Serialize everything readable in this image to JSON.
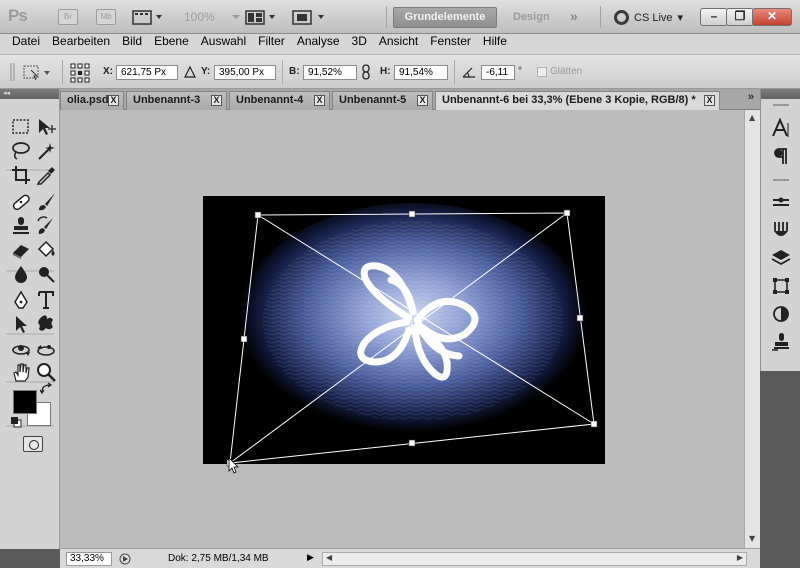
{
  "app": {
    "logo": "Ps",
    "bridge_label": "Br",
    "minibridge_label": "Mb",
    "zoom": "100%",
    "workspace_active": "Grundelemente",
    "workspace_design": "Design",
    "workspace_more": "»",
    "cs_live": "CS Live"
  },
  "menu": [
    "Datei",
    "Bearbeiten",
    "Bild",
    "Ebene",
    "Auswahl",
    "Filter",
    "Analyse",
    "3D",
    "Ansicht",
    "Fenster",
    "Hilfe"
  ],
  "options": {
    "x_label": "X:",
    "x_value": "621,75 Px",
    "y_label": "Y:",
    "y_value": "395,00 Px",
    "w_label": "B:",
    "w_value": "91,52%",
    "h_label": "H:",
    "h_value": "91,54%",
    "angle_value": "-6,11",
    "angle_unit": "°",
    "smooth_label": "Glätten"
  },
  "tabs": [
    {
      "label": "olia.psd",
      "active": false
    },
    {
      "label": "Unbenannt-3",
      "active": false
    },
    {
      "label": "Unbenannt-4",
      "active": false
    },
    {
      "label": "Unbenannt-5",
      "active": false
    },
    {
      "label": "Unbenannt-6 bei 33,3% (Ebene 3 Kopie, RGB/8) *",
      "active": true
    }
  ],
  "tab_close": "X",
  "tab_more": "»",
  "status": {
    "zoom": "33,33%",
    "doc": "Dok: 2,75 MB/1,34 MB"
  },
  "colors": {
    "foreground": "#000000",
    "background": "#ffffff",
    "image_glow": "#4b5fa0"
  }
}
